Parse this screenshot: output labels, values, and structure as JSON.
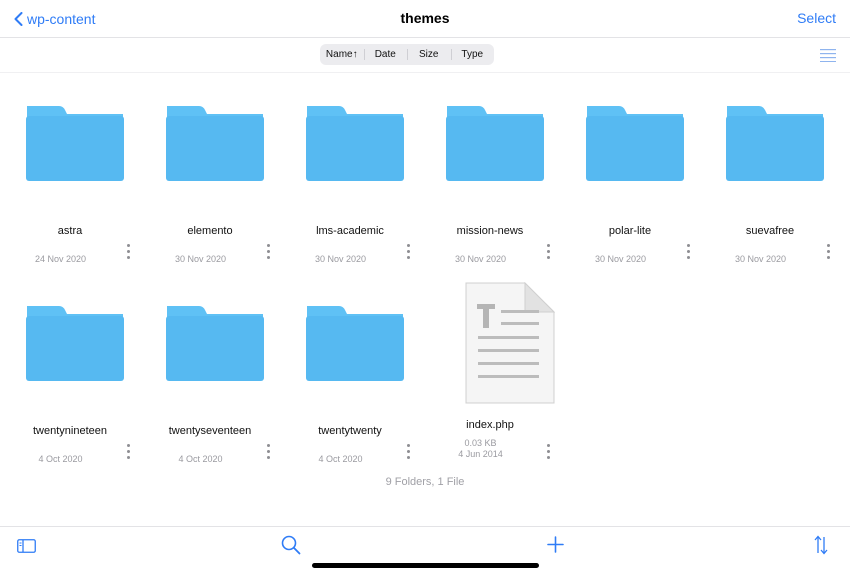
{
  "navbar": {
    "back_label": "wp-content",
    "title": "themes",
    "select_label": "Select"
  },
  "sort": {
    "options": [
      "Name↑",
      "Date",
      "Size",
      "Type"
    ]
  },
  "items": [
    {
      "kind": "folder",
      "name": "astra",
      "date": "24 Nov 2020"
    },
    {
      "kind": "folder",
      "name": "elemento",
      "date": "30 Nov 2020"
    },
    {
      "kind": "folder",
      "name": "lms-academic",
      "date": "30 Nov 2020"
    },
    {
      "kind": "folder",
      "name": "mission-news",
      "date": "30 Nov 2020"
    },
    {
      "kind": "folder",
      "name": "polar-lite",
      "date": "30 Nov 2020"
    },
    {
      "kind": "folder",
      "name": "suevafree",
      "date": "30 Nov 2020"
    },
    {
      "kind": "folder",
      "name": "twentynineteen",
      "date": "4 Oct 2020"
    },
    {
      "kind": "folder",
      "name": "twentyseventeen",
      "date": "4 Oct 2020"
    },
    {
      "kind": "folder",
      "name": "twentytwenty",
      "date": "4 Oct 2020"
    },
    {
      "kind": "file",
      "name": "index.php",
      "size": "0.03 KB",
      "date": "4 Jun 2014"
    }
  ],
  "summary": "9 Folders, 1 File",
  "colors": {
    "accent": "#2f7cf6",
    "folder": "#56b9f1",
    "folder_tab": "#5fc1f5"
  },
  "toolbar": {
    "icons": [
      "sidebar-icon",
      "search-icon",
      "plus-icon",
      "sort-arrows-icon"
    ]
  }
}
